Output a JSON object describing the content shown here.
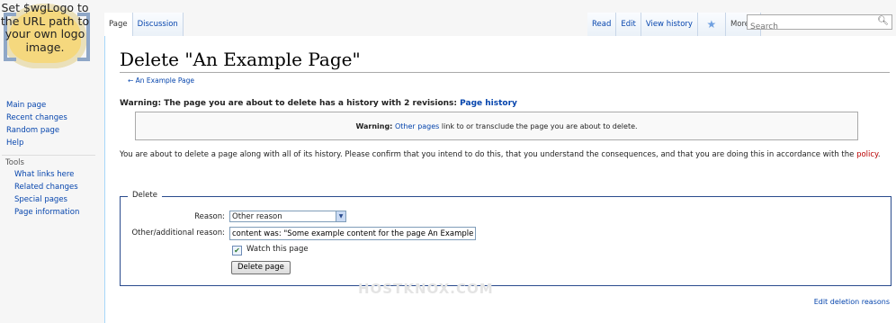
{
  "logo": {
    "text": "Set $wgLogo to the URL path to your own logo image."
  },
  "sidebar": {
    "nav": [
      "Main page",
      "Recent changes",
      "Random page",
      "Help"
    ],
    "tools_heading": "Tools",
    "tools": [
      "What links here",
      "Related changes",
      "Special pages",
      "Page information"
    ]
  },
  "tabs": {
    "left": [
      "Page",
      "Discussion"
    ],
    "right": [
      "Read",
      "Edit",
      "View history"
    ],
    "more": "More ▾"
  },
  "search": {
    "placeholder": "Search"
  },
  "content": {
    "title": "Delete \"An Example Page\"",
    "backlink": "← An Example Page",
    "history_warning": "Warning: The page you are about to delete has a history with 2 revisions:",
    "history_link": "Page history",
    "box_warning_prefix": "Warning:",
    "box_warning_link": "Other pages",
    "box_warning_rest": "link to or transclude the page you are about to delete.",
    "explain_text": "You are about to delete a page along with all of its history. Please confirm that you intend to do this, that you understand the consequences, and that you are doing this in accordance with the",
    "explain_link": "policy",
    "explain_end": "."
  },
  "form": {
    "legend": "Delete",
    "reason_label": "Reason:",
    "reason_value": "Other reason",
    "other_label": "Other/additional reason:",
    "other_value": "content was: \"Some example content for the page An Example",
    "watch_label": "Watch this page",
    "watch_checked": true,
    "submit_label": "Delete page"
  },
  "edit_reasons_link": "Edit deletion reasons",
  "watermark": "HOSTKNOX.COM"
}
